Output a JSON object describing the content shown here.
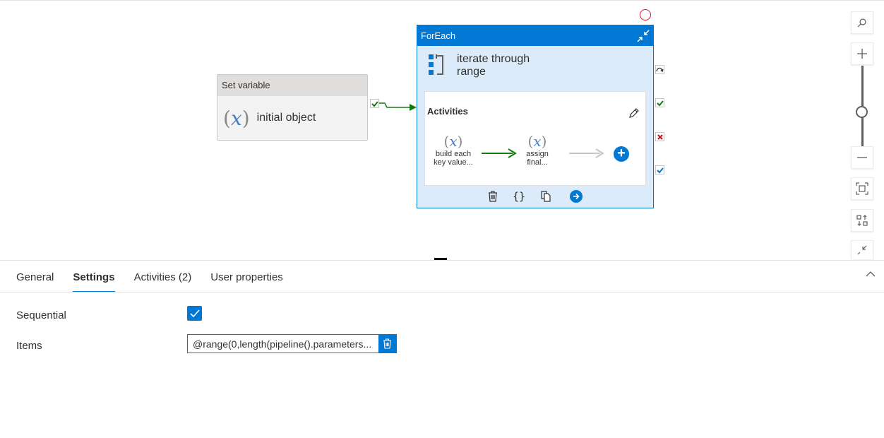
{
  "canvas": {
    "set_variable": {
      "header": "Set variable",
      "name": "initial object"
    },
    "foreach": {
      "header": "ForEach",
      "name_line1": "iterate through",
      "name_line2": "range",
      "activities_label": "Activities",
      "inner_activities": [
        {
          "line1": "build each",
          "line2": "key value..."
        },
        {
          "line1": "assign",
          "line2": "final..."
        }
      ],
      "toolbar_icons": [
        "delete-icon",
        "code-icon",
        "copy-icon",
        "navigate-icon"
      ]
    },
    "var_icon_glyph": "x",
    "colors": {
      "accent": "#0078d4",
      "success": "#107c10",
      "fail": "#e81123",
      "node_header": "#e1dfdd",
      "foreach_body": "#dcebfa"
    },
    "right_tools": [
      "search-icon",
      "zoom-in-icon",
      "zoom-slider",
      "zoom-out-icon",
      "fit-to-screen-icon",
      "auto-align-icon",
      "collapse-icon"
    ]
  },
  "panel": {
    "tabs": [
      {
        "label": "General",
        "active": false
      },
      {
        "label": "Settings",
        "active": true
      },
      {
        "label": "Activities (2)",
        "active": false
      },
      {
        "label": "User properties",
        "active": false
      }
    ],
    "sequential_label": "Sequential",
    "sequential_checked": true,
    "items_label": "Items",
    "items_value": "@range(0,length(pipeline().parameters..."
  }
}
